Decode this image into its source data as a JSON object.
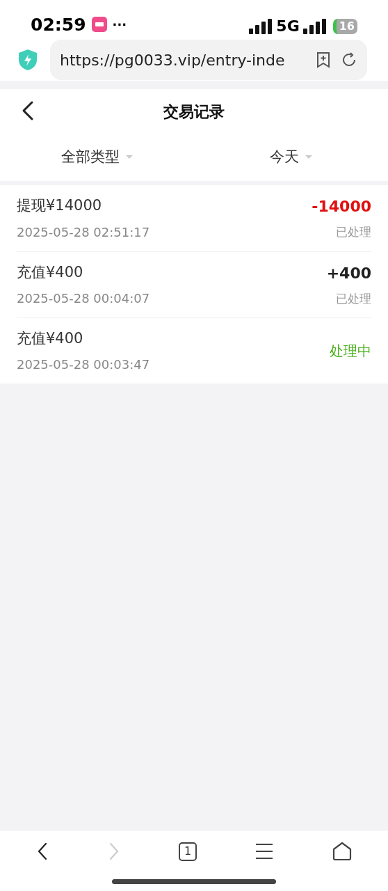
{
  "status_bar": {
    "time": "02:59",
    "more": "···",
    "network": "5G",
    "battery": "16"
  },
  "address_bar": {
    "url": "https://pg0033.vip/entry-inde"
  },
  "header": {
    "title": "交易记录"
  },
  "filters": [
    {
      "label": "全部类型"
    },
    {
      "label": "今天"
    }
  ],
  "transactions": [
    {
      "title": "提现¥14000",
      "date": "2025-05-28 02:51:17",
      "amount": "-14000",
      "kind": "withdrawal",
      "status": "已处理",
      "pending": false
    },
    {
      "title": "充值¥400",
      "date": "2025-05-28 00:04:07",
      "amount": "+400",
      "kind": "deposit",
      "status": "已处理",
      "pending": false
    },
    {
      "title": "充值¥400",
      "date": "2025-05-28 00:03:47",
      "status": "处理中",
      "pending": true
    }
  ],
  "toolbar": {
    "forward_disabled": true,
    "tab_count": "1"
  }
}
